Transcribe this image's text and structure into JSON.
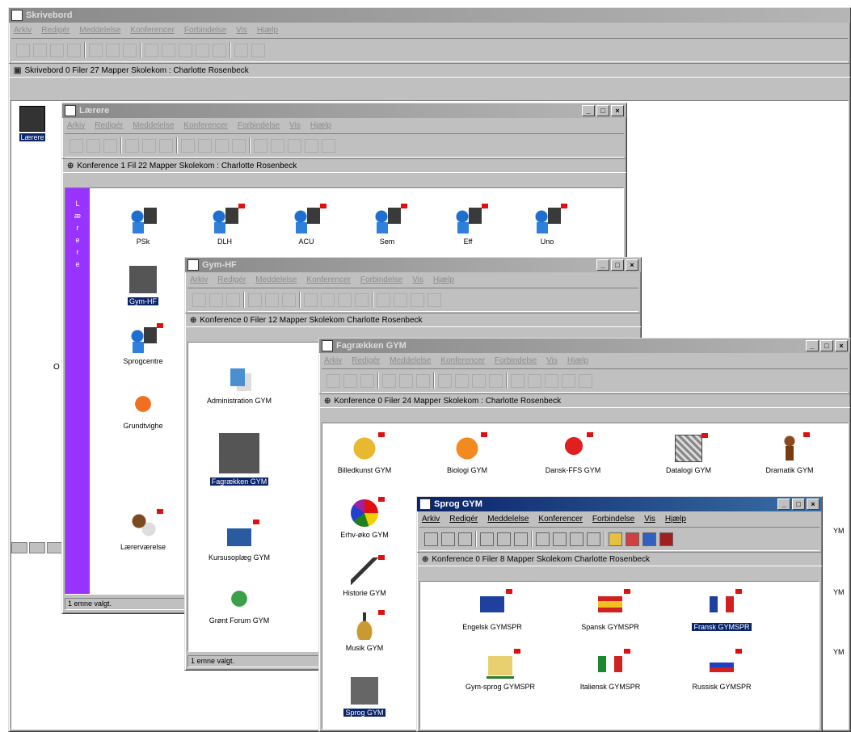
{
  "main": {
    "title": "Skrivebord",
    "menu": [
      "Arkiv",
      "Redigér",
      "Meddelelse",
      "Konferencer",
      "Forbindelse",
      "Vis",
      "Hjælp"
    ],
    "info": "Skrivebord   0 Filer  27 Mapper   Skolekom : Charlotte Rosenbeck",
    "desktop_icon": "Lærere",
    "side_letter": "O"
  },
  "laerere": {
    "title": "Lærere",
    "menu": [
      "Arkiv",
      "Redigér",
      "Meddelelse",
      "Konferencer",
      "Forbindelse",
      "Vis",
      "Hjælp"
    ],
    "info": "Konference   1 Fil  22 Mapper   Skolekom : Charlotte Rosenbeck",
    "controls": [
      "_",
      "□",
      "×"
    ],
    "side_text": [
      "L",
      "æ",
      "r",
      "e",
      "r",
      "e"
    ],
    "icons": [
      "PSk",
      "DLH",
      "ACU",
      "Sem",
      "Eff",
      "Uno",
      "Gym-HF",
      "Sprogcentre",
      "Grundtvighe",
      "Lærerværelse"
    ],
    "status": "1 emne valgt."
  },
  "gymhf": {
    "title": "Gym-HF",
    "menu": [
      "Arkiv",
      "Redigér",
      "Meddelelse",
      "Konferencer",
      "Forbindelse",
      "Vis",
      "Hjælp"
    ],
    "info": "Konference   0 Filer  12 Mapper   Skolekom   Charlotte Rosenbeck",
    "controls": [
      "_",
      "□",
      "×"
    ],
    "icons": [
      "Administration GYM",
      "Fagrækken GYM",
      "Kursusoplæg GYM",
      "Grønt Forum GYM"
    ],
    "status": "1 emne valgt."
  },
  "fagraekken": {
    "title": "Fagrækken GYM",
    "menu": [
      "Arkiv",
      "Redigér",
      "Meddelelse",
      "Konferencer",
      "Forbindelse",
      "Vis",
      "Hjælp"
    ],
    "info": "Konference   0 Filer  24 Mapper   Skolekom : Charlotte Rosenbeck",
    "controls": [
      "_",
      "□",
      "×"
    ],
    "icons": [
      "Billedkunst GYM",
      "Biologi GYM",
      "Dansk-FFS GYM",
      "Datalogi GYM",
      "Dramatik GYM",
      "Erhv-øko GYM",
      "Historie GYM",
      "Musik GYM",
      "Sprog GYM"
    ],
    "edge": [
      "YM",
      "YM",
      "YM"
    ]
  },
  "sprog": {
    "title": "Sprog GYM",
    "menu": [
      "Arkiv",
      "Redigér",
      "Meddelelse",
      "Konferencer",
      "Forbindelse",
      "Vis",
      "Hjælp"
    ],
    "info": "Konference   0 Filer  8 Mapper   Skolekom   Charlotte Rosenbeck",
    "controls": [
      "_",
      "□",
      "×"
    ],
    "icons": [
      "Engelsk GYMSPR",
      "Spansk GYMSPR",
      "Fransk GYMSPR",
      "Gym-sprog GYMSPR",
      "Italiensk GYMSPR",
      "Russisk GYMSPR"
    ]
  },
  "taskbar": [
    "",
    ""
  ],
  "colors": {
    "active_title": "#0a246a",
    "purple": "#9933ff",
    "flag": "#e01010"
  }
}
